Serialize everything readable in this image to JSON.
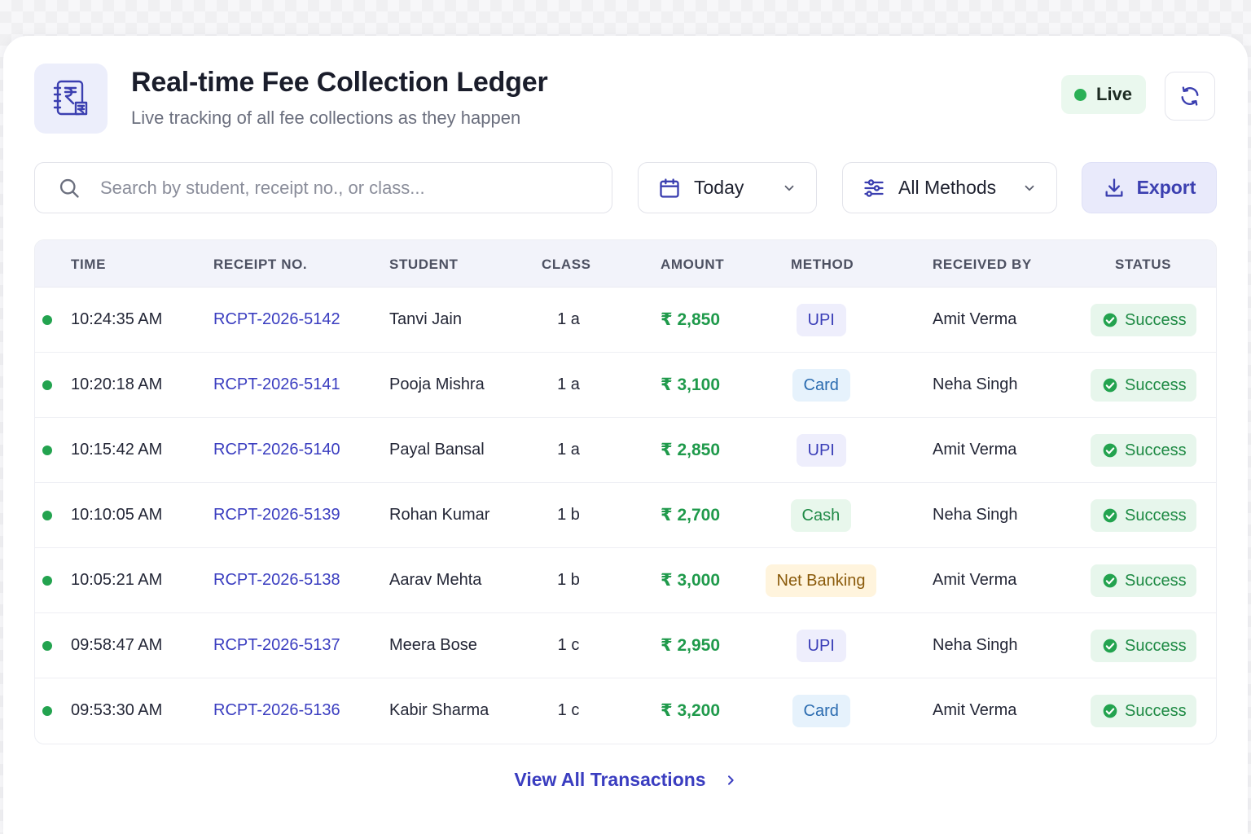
{
  "header": {
    "title": "Real-time Fee Collection Ledger",
    "subtitle": "Live tracking of all fee collections as they happen",
    "live_label": "Live",
    "logo_icon": "rupee-ledger-icon",
    "refresh_icon": "refresh-icon"
  },
  "filters": {
    "search_placeholder": "Search by student, receipt no., or class...",
    "search_value": "",
    "date_selected": "Today",
    "method_selected": "All Methods",
    "export_label": "Export"
  },
  "table": {
    "columns": [
      "TIME",
      "RECEIPT NO.",
      "STUDENT",
      "CLASS",
      "AMOUNT",
      "METHOD",
      "RECEIVED BY",
      "STATUS"
    ],
    "rows": [
      {
        "time": "10:24:35 AM",
        "receipt": "RCPT-2026-5142",
        "student": "Tanvi Jain",
        "class": "1 a",
        "amount": "₹ 2,850",
        "method": "UPI",
        "received_by": "Amit Verma",
        "status": "Success"
      },
      {
        "time": "10:20:18 AM",
        "receipt": "RCPT-2026-5141",
        "student": "Pooja Mishra",
        "class": "1 a",
        "amount": "₹ 3,100",
        "method": "Card",
        "received_by": "Neha Singh",
        "status": "Success"
      },
      {
        "time": "10:15:42 AM",
        "receipt": "RCPT-2026-5140",
        "student": "Payal Bansal",
        "class": "1 a",
        "amount": "₹ 2,850",
        "method": "UPI",
        "received_by": "Amit Verma",
        "status": "Success"
      },
      {
        "time": "10:10:05 AM",
        "receipt": "RCPT-2026-5139",
        "student": "Rohan Kumar",
        "class": "1 b",
        "amount": "₹ 2,700",
        "method": "Cash",
        "received_by": "Neha Singh",
        "status": "Success"
      },
      {
        "time": "10:05:21 AM",
        "receipt": "RCPT-2026-5138",
        "student": "Aarav Mehta",
        "class": "1 b",
        "amount": "₹ 3,000",
        "method": "Net Banking",
        "received_by": "Amit Verma",
        "status": "Success"
      },
      {
        "time": "09:58:47 AM",
        "receipt": "RCPT-2026-5137",
        "student": "Meera Bose",
        "class": "1 c",
        "amount": "₹ 2,950",
        "method": "UPI",
        "received_by": "Neha Singh",
        "status": "Success"
      },
      {
        "time": "09:53:30 AM",
        "receipt": "RCPT-2026-5136",
        "student": "Kabir Sharma",
        "class": "1 c",
        "amount": "₹ 3,200",
        "method": "Card",
        "received_by": "Amit Verma",
        "status": "Success"
      }
    ]
  },
  "footer": {
    "view_all_label": "View All Transactions"
  },
  "colors": {
    "accent": "#3a3dc0",
    "success": "#23a34f",
    "amount": "#1f9a4b"
  }
}
